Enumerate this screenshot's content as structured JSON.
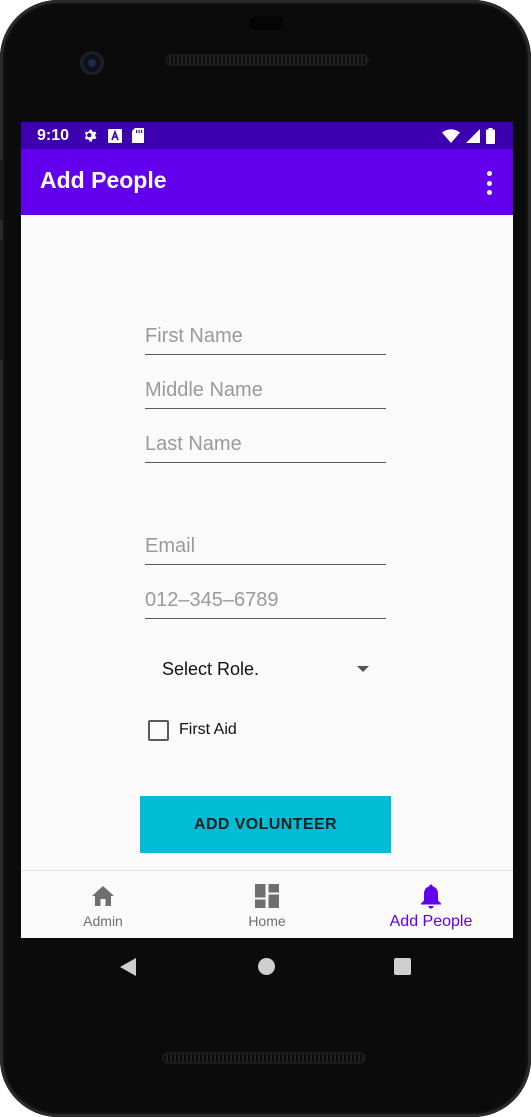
{
  "colors": {
    "status_bar": "#3d00b0",
    "app_bar": "#6200ee",
    "button": "#00bcd4",
    "nav_active": "#6200ee",
    "nav_inactive": "#6f6f6f"
  },
  "status_bar": {
    "time": "9:10",
    "left_icons": [
      "settings-icon",
      "a-icon",
      "sd-card-icon"
    ],
    "right_icons": [
      "wifi-icon",
      "signal-icon",
      "battery-icon"
    ]
  },
  "app_bar": {
    "title": "Add People",
    "menu_icon": "overflow-menu-icon"
  },
  "form": {
    "first_name_placeholder": "First Name",
    "middle_name_placeholder": "Middle Name",
    "last_name_placeholder": "Last Name",
    "email_placeholder": "Email",
    "phone_placeholder": "012–345–6789",
    "role_selected": "Select Role.",
    "first_aid_label": "First Aid",
    "first_aid_checked": false,
    "submit_label": "ADD VOLUNTEER"
  },
  "bottom_nav": {
    "items": [
      {
        "label": "Admin",
        "icon": "home-icon",
        "active": false
      },
      {
        "label": "Home",
        "icon": "dashboard-icon",
        "active": false
      },
      {
        "label": "Add People",
        "icon": "bell-icon",
        "active": true
      }
    ]
  }
}
